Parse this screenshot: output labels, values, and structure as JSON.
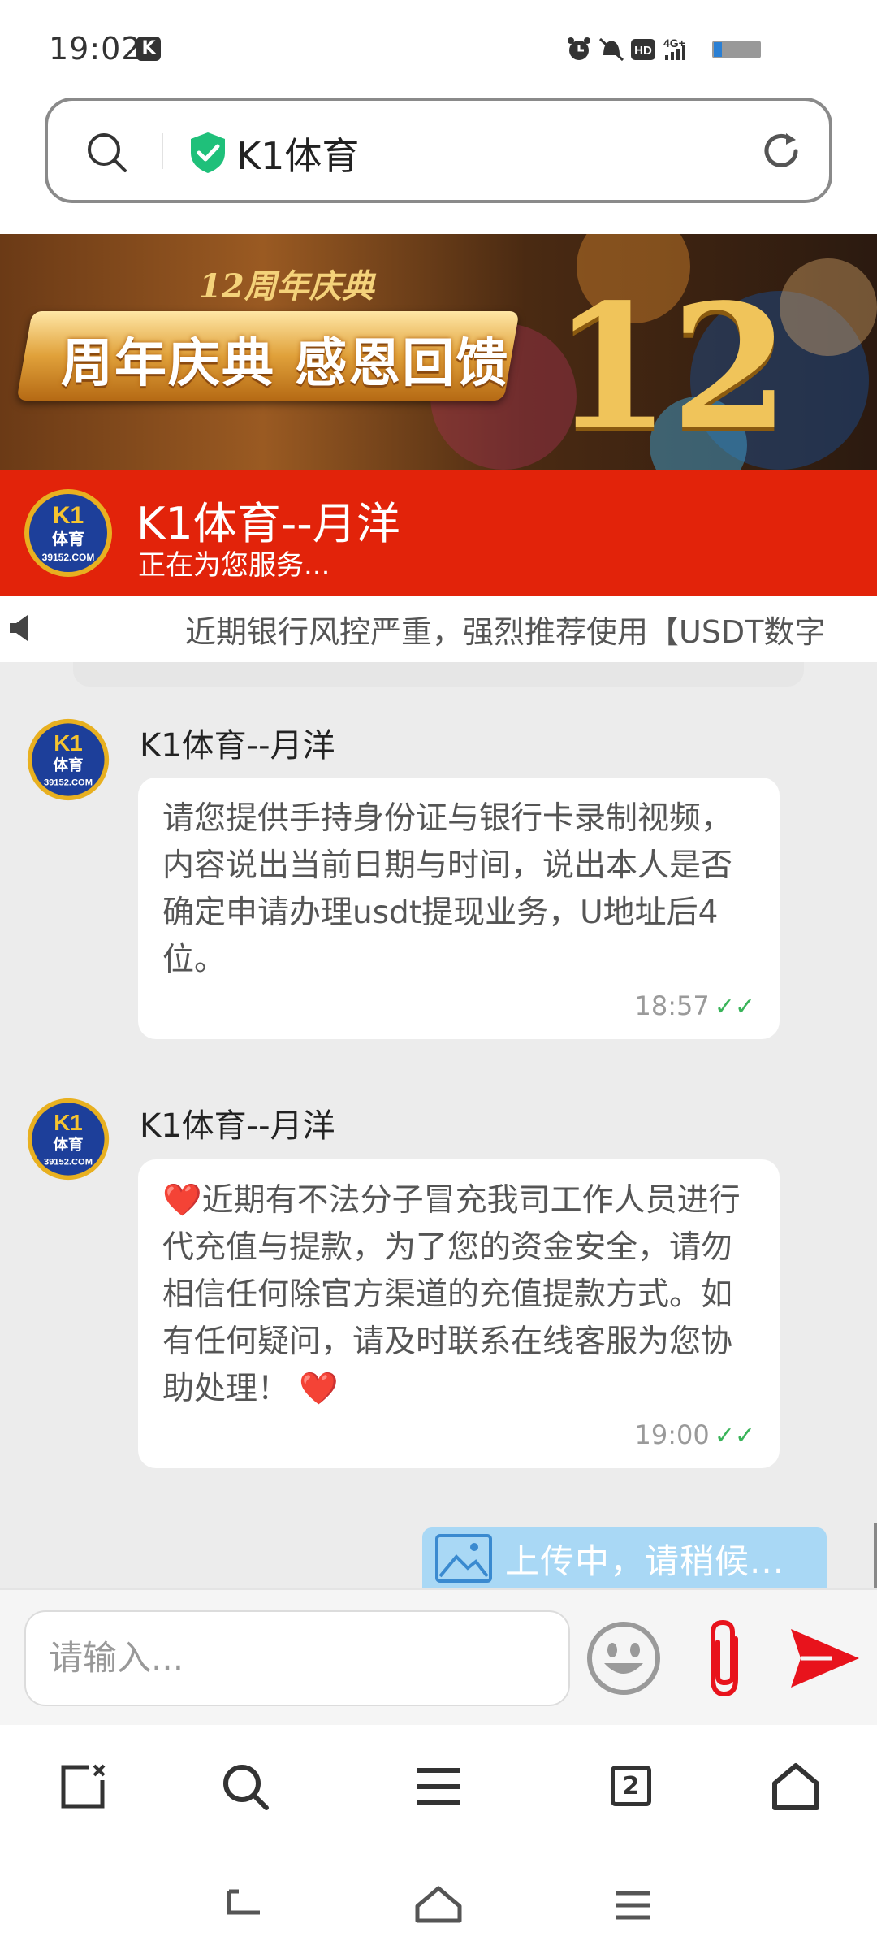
{
  "status_bar": {
    "time": "19:02",
    "app_badge": "K",
    "hd_label": "HD",
    "network_label": "4G+"
  },
  "address_bar": {
    "title": "K1体育"
  },
  "banner": {
    "subtitle": "12周年庆典",
    "title": "周年庆典 感恩回馈",
    "big_number": "12"
  },
  "chat_header": {
    "agent_name": "K1体育--月洋",
    "status": "正在为您服务...",
    "avatar_line1": "K1",
    "avatar_line2": "体育",
    "avatar_line3": "39152.COM"
  },
  "notice": {
    "text": "近期银行风控严重，强烈推荐使用【USDT数字"
  },
  "messages": [
    {
      "sender": "K1体育--月洋",
      "text": "请您提供手持身份证与银行卡录制视频，内容说出当前日期与时间，说出本人是否确定申请办理usdt提现业务，U地址后4位。",
      "time": "18:57"
    },
    {
      "sender": "K1体育--月洋",
      "text_prefix": "❤️",
      "text": "近期有不法分子冒充我司工作人员进行代充值与提款，为了您的资金安全，请勿相信任何除官方渠道的充值提款方式。如有任何疑问，请及时联系在线客服为您协助处理！",
      "text_suffix": "❤️",
      "time": "19:00"
    }
  ],
  "upload": {
    "text": "上传中，请稍候..."
  },
  "input": {
    "placeholder": "请输入..."
  },
  "browser_toolbar": {
    "tab_count": "2"
  },
  "colors": {
    "header_red": "#e2230a",
    "send_red": "#e8131c",
    "check_green": "#3ab45a",
    "shield_green": "#1fc07a",
    "upload_blue": "#a9d8f5"
  }
}
